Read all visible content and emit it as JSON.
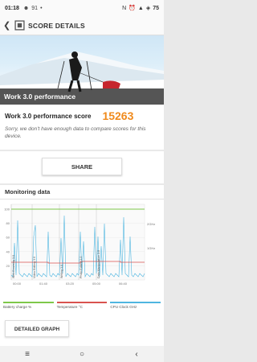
{
  "status_bar": {
    "time": "01:18",
    "notification_count": "91",
    "battery": "75"
  },
  "app_bar": {
    "title": "SCORE DETAILS"
  },
  "hero": {
    "caption": "Work 3.0 performance"
  },
  "score": {
    "label": "Work 3.0 performance score",
    "value": "15263",
    "note": "Sorry, we don't have enough data to compare scores for this device."
  },
  "share_button": "SHARE",
  "monitoring": {
    "heading": "Monitoring data",
    "y_left_ticks": [
      "100",
      "80",
      "60",
      "40",
      "20"
    ],
    "y_right_ticks": [
      "2GHz",
      "1GHz"
    ],
    "x_ticks": [
      "00:00",
      "01:40",
      "03:20",
      "05:00",
      "06:40"
    ],
    "segment_labels": [
      "Web Browsing 3.0",
      "Video Editing 3.0",
      "Writing 3.0",
      "Photo Editing 3.0",
      "Data Manipulation 3.0"
    ],
    "legend": [
      {
        "label": "Battery charge %",
        "color": "#7ec84a"
      },
      {
        "label": "Temperature °C",
        "color": "#d9534f"
      },
      {
        "label": "CPU Clock GHz",
        "color": "#4fb6e0"
      }
    ]
  },
  "detail_button": "DETAILED GRAPH",
  "nav": {
    "menu": "≡",
    "home": "○",
    "back": "‹"
  }
}
